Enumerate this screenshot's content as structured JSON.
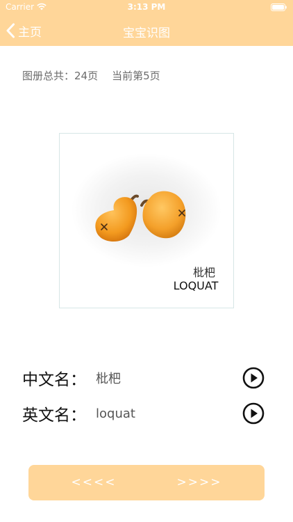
{
  "status_bar": {
    "carrier": "Carrier",
    "time": "3:13 PM"
  },
  "nav": {
    "back_label": "主页",
    "title": "宝宝识图"
  },
  "page_info": {
    "total_text": "图册总共：24页",
    "current_text": "当前第5页"
  },
  "card": {
    "image_caption_cn": "枇杷",
    "image_caption_en": "LOQUAT"
  },
  "labels": {
    "chinese_key": "中文名：",
    "chinese_value": "枇杷",
    "english_key": "英文名：",
    "english_value": "loquat"
  },
  "pager": {
    "prev_label": "<<<<",
    "next_label": ">>>>"
  },
  "colors": {
    "header_bg": "#ffd699",
    "accent": "#ffd699",
    "fruit": "#f39a1f"
  },
  "icons": {
    "back": "chevron-left-icon",
    "wifi": "wifi-icon",
    "battery": "battery-icon",
    "play": "play-circle-icon"
  }
}
